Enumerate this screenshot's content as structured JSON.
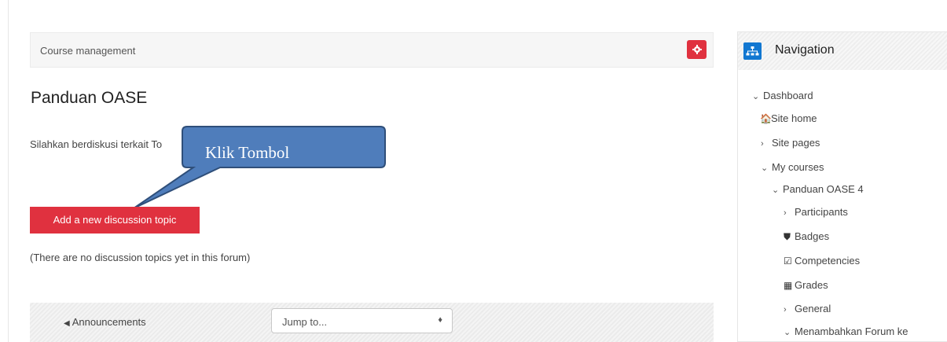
{
  "course_header": {
    "title": "Course management"
  },
  "main": {
    "page_title": "Panduan OASE",
    "intro": "Silahkan berdiskusi terkait To",
    "callout_text": "Klik Tombol",
    "add_button": "Add a new discussion topic",
    "empty_message": "(There are no discussion topics yet in this forum)",
    "prev_link": "Announcements",
    "prev_arrow": "◀",
    "jump_select": "Jump to...",
    "jump_caret": "♦"
  },
  "navigation": {
    "title": "Navigation",
    "items": [
      {
        "label": "Dashboard",
        "marker": "⌄",
        "icon": ""
      },
      {
        "label": "Site home",
        "marker": "",
        "icon": "🏠"
      },
      {
        "label": "Site pages",
        "marker": "›",
        "icon": ""
      },
      {
        "label": "My courses",
        "marker": "⌄",
        "icon": ""
      },
      {
        "label": "Panduan OASE 4",
        "marker": "⌄",
        "icon": ""
      },
      {
        "label": "Participants",
        "marker": "›",
        "icon": ""
      },
      {
        "label": "Badges",
        "marker": "",
        "icon": "⛊"
      },
      {
        "label": "Competencies",
        "marker": "",
        "icon": "☑"
      },
      {
        "label": "Grades",
        "marker": "",
        "icon": "▦"
      },
      {
        "label": "General",
        "marker": "›",
        "icon": ""
      },
      {
        "label": "Menambahkan Forum ke",
        "marker": "⌄",
        "icon": ""
      }
    ]
  },
  "colors": {
    "accent_red": "#e0313f",
    "nav_blue": "#1177d1",
    "callout_blue": "#4f7dbb"
  }
}
